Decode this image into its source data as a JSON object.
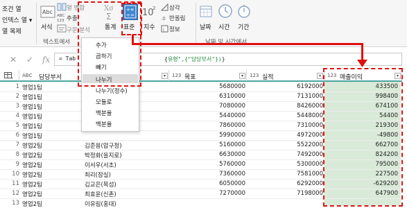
{
  "ribbon": {
    "left_cmds": [
      "조건 열",
      "인덱스 열",
      "열 복제"
    ],
    "left_cmd_arrow": "▾",
    "text_group": {
      "label": "텍스트에서",
      "format_label": "서식",
      "merge_columns": "열 병합",
      "extract": "추출",
      "parse": "구문 분석"
    },
    "number_group": {
      "statistics": "통계",
      "standard": "표준",
      "scientific": "지수",
      "trigonometry": "삼각",
      "rounding": "반올림",
      "information": "정보"
    },
    "datetime_group": {
      "label": "날짜 및 시간에서",
      "date": "날짜",
      "time": "시간",
      "duration": "기간"
    }
  },
  "formula": {
    "cancel": "✕",
    "confirm": "✓",
    "fx": "fx",
    "text_left": "= Tab",
    "text_right": "유형\",{\"담당부서\"})"
  },
  "table": {
    "columns": [
      {
        "type": "ABC",
        "name": "담당부서"
      },
      {
        "type": "123",
        "name": "목표"
      },
      {
        "type": "123",
        "name": "실적"
      },
      {
        "type": "123",
        "name": "매출이익"
      }
    ],
    "rows": [
      {
        "n": "1",
        "dept": "영업1팀",
        "person": "",
        "target": "5680000",
        "actual": "6192000",
        "profit": "433500"
      },
      {
        "n": "2",
        "dept": "영업1팀",
        "person": "",
        "target": "6310000",
        "actual": "7131000",
        "profit": "998400"
      },
      {
        "n": "3",
        "dept": "영업1팀",
        "person": "",
        "target": "7080000",
        "actual": "8426000",
        "profit": "674100"
      },
      {
        "n": "4",
        "dept": "영업1팀",
        "person": "",
        "target": "5440000",
        "actual": "5448000",
        "profit": "54400"
      },
      {
        "n": "5",
        "dept": "영업1팀",
        "person": "",
        "target": "7860000",
        "actual": "7310000",
        "profit": "219300"
      },
      {
        "n": "6",
        "dept": "영업1팀",
        "person": "",
        "target": "5990000",
        "actual": "4972000",
        "profit": "-49800"
      },
      {
        "n": "7",
        "dept": "영업2팀",
        "person": "김준용(압구정)",
        "target": "5160000",
        "actual": "5522000",
        "profit": "662700"
      },
      {
        "n": "8",
        "dept": "영업2팀",
        "person": "박정화(을지로)",
        "target": "6630000",
        "actual": "7492000",
        "profit": "824200"
      },
      {
        "n": "9",
        "dept": "영업2팀",
        "person": "이서우(서초)",
        "target": "5760000",
        "actual": "5300000",
        "profit": "795000"
      },
      {
        "n": "10",
        "dept": "영업2팀",
        "person": "최리(잠실)",
        "target": "7360000",
        "actual": "7581000",
        "profit": "227500"
      },
      {
        "n": "11",
        "dept": "영업2팀",
        "person": "김교은(목섬)",
        "target": "6050000",
        "actual": "6292000",
        "profit": "-629200"
      },
      {
        "n": "12",
        "dept": "영업2팀",
        "person": "최효윤(신촌)",
        "target": "7270000",
        "actual": "7198000",
        "profit": "647900"
      },
      {
        "n": "13",
        "dept": "영업2팀",
        "person": "이유림(홍대)",
        "target": "",
        "actual": "",
        "profit": ""
      }
    ]
  },
  "menu": {
    "items": [
      "추가",
      "곱하기",
      "빼기",
      "나누기",
      "나누기(정수)",
      "모듈로",
      "백분율",
      "백분율"
    ],
    "highlighted_index": 3
  },
  "colors": {
    "highlight": "#e01010",
    "profit_column": "#d9ead8",
    "header_underline": "#4aa3a0"
  }
}
